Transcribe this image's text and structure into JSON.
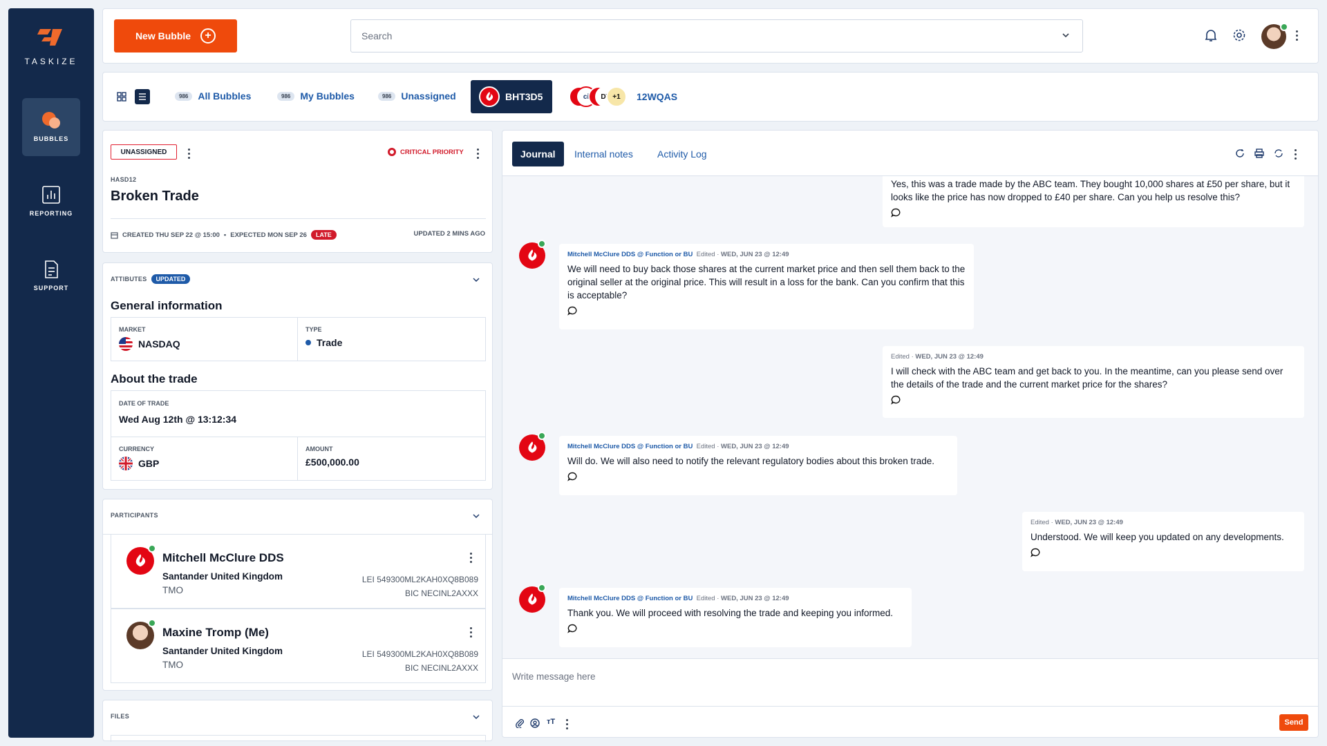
{
  "app": {
    "name": "TASKIZE",
    "brand_color": "#ef4a0c",
    "navy": "#13294b"
  },
  "sidebar": {
    "items": [
      {
        "label": "BUBBLES",
        "icon": "bubbles-icon",
        "active": true
      },
      {
        "label": "REPORTING",
        "icon": "reporting-icon",
        "active": false
      },
      {
        "label": "SUPPORT",
        "icon": "support-icon",
        "active": false
      }
    ]
  },
  "topbar": {
    "new_bubble_label": "New Bubble",
    "search_placeholder": "Search"
  },
  "tabsbar": {
    "tabs": [
      {
        "count": "986",
        "label": "All Bubbles"
      },
      {
        "count": "986",
        "label": "My Bubbles"
      },
      {
        "count": "986",
        "label": "Unassigned"
      }
    ],
    "active_bubble": "BHT3D5",
    "group": {
      "label": "12WQAS",
      "extra": "+1",
      "abbr1": "ci",
      "abbr2": "DT"
    }
  },
  "bubble": {
    "status": "UNASSIGNED",
    "priority": "CRITICAL PRIORITY",
    "id": "HASD12",
    "title": "Broken Trade",
    "created": "CREATED THU SEP 22 @ 15:00",
    "expected": "EXPECTED MON SEP 26",
    "late": "LATE",
    "updated": "UPDATED 2 MINS AGO"
  },
  "attributes": {
    "label": "ATTIBUTES",
    "badge": "UPDATED",
    "general_title": "General information",
    "market_label": "MARKET",
    "market_value": "NASDAQ",
    "type_label": "TYPE",
    "type_value": "Trade",
    "trade_title": "About the trade",
    "date_label": "DATE OF TRADE",
    "date_value": "Wed Aug 12th @ 13:12:34",
    "currency_label": "CURRENCY",
    "currency_value": "GBP",
    "amount_label": "AMOUNT",
    "amount_value": "£500,000.00"
  },
  "participants": {
    "label": "PARTICIPANTS",
    "items": [
      {
        "name": "Mitchell McClure DDS",
        "org": "Santander United Kingdom",
        "role": "TMO",
        "lei": "LEI 549300ML2KAH0XQ8B089",
        "bic": "BIC NECINL2AXXX"
      },
      {
        "name": "Maxine Tromp (Me)",
        "org": "Santander United Kingdom",
        "role": "TMO",
        "lei": "LEI 549300ML2KAH0XQ8B089",
        "bic": "BIC NECINL2AXXX"
      }
    ]
  },
  "files": {
    "label": "FILES"
  },
  "panel": {
    "tabs": [
      "Journal",
      "Internal notes",
      "Activity Log"
    ],
    "messages": [
      {
        "text": "Yes, this was a trade made by the ABC team. They bought 10,000 shares at £50 per share, but it looks like the price has now dropped to £40 per share. Can you help us resolve this?"
      },
      {
        "author": "Mitchell McClure DDS",
        "at": "@",
        "function": "Function or BU",
        "edited": "Edited ·",
        "time": "WED, JUN 23 @  12:49",
        "text": "We will need to buy back those shares at the current market price and then sell them back to the original seller at the original price. This will result in a loss for the bank. Can you confirm that this is acceptable?"
      },
      {
        "edited": "Edited ·",
        "time": "WED, JUN 23 @  12:49",
        "text": "I will check with the ABC team and get back to you. In the meantime, can you please send over the details of the trade and the current market price for the shares?"
      },
      {
        "author": "Mitchell McClure DDS",
        "at": "@",
        "function": "Function or BU",
        "edited": "Edited ·",
        "time": "WED, JUN 23 @  12:49",
        "text": "Will do. We will also need to notify the relevant regulatory bodies about this broken trade."
      },
      {
        "edited": "Edited ·",
        "time": "WED, JUN 23 @  12:49",
        "text": "Understood. We will keep you updated on any developments."
      },
      {
        "author": "Mitchell McClure DDS",
        "at": "@",
        "function": "Function or BU",
        "edited": "Edited ·",
        "time": "WED, JUN 23 @  12:49",
        "text": "Thank you. We will proceed with resolving the trade and keeping you informed."
      }
    ],
    "composer_placeholder": "Write message here",
    "send_label": "Send"
  }
}
